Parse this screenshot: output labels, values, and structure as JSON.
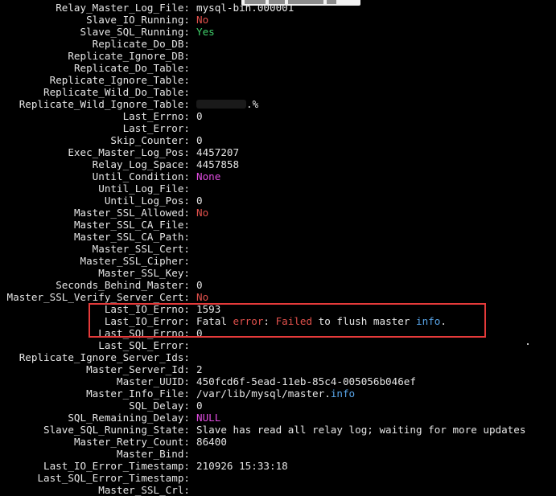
{
  "terminal": {
    "lines": [
      {
        "key": "Relay_Master_Log_File:",
        "segments": [
          {
            "text": "mysql-bin.000001",
            "color": "normal"
          }
        ]
      },
      {
        "key": "Slave_IO_Running:",
        "segments": [
          {
            "text": "No",
            "color": "red"
          }
        ]
      },
      {
        "key": "Slave_SQL_Running:",
        "segments": [
          {
            "text": "Yes",
            "color": "green"
          }
        ]
      },
      {
        "key": "Replicate_Do_DB:",
        "segments": []
      },
      {
        "key": "Replicate_Ignore_DB:",
        "segments": []
      },
      {
        "key": "Replicate_Do_Table:",
        "segments": []
      },
      {
        "key": "Replicate_Ignore_Table:",
        "segments": []
      },
      {
        "key": "Replicate_Wild_Do_Table:",
        "segments": []
      },
      {
        "key": "Replicate_Wild_Ignore_Table:",
        "redacted": true,
        "segments": [
          {
            "text": ".%",
            "color": "normal"
          }
        ]
      },
      {
        "key": "Last_Errno:",
        "segments": [
          {
            "text": "0",
            "color": "normal"
          }
        ]
      },
      {
        "key": "Last_Error:",
        "segments": []
      },
      {
        "key": "Skip_Counter:",
        "segments": [
          {
            "text": "0",
            "color": "normal"
          }
        ]
      },
      {
        "key": "Exec_Master_Log_Pos:",
        "segments": [
          {
            "text": "4457207",
            "color": "normal"
          }
        ]
      },
      {
        "key": "Relay_Log_Space:",
        "segments": [
          {
            "text": "4457858",
            "color": "normal"
          }
        ]
      },
      {
        "key": "Until_Condition:",
        "segments": [
          {
            "text": "None",
            "color": "magenta"
          }
        ]
      },
      {
        "key": "Until_Log_File:",
        "segments": []
      },
      {
        "key": "Until_Log_Pos:",
        "segments": [
          {
            "text": "0",
            "color": "normal"
          }
        ]
      },
      {
        "key": "Master_SSL_Allowed:",
        "segments": [
          {
            "text": "No",
            "color": "red"
          }
        ]
      },
      {
        "key": "Master_SSL_CA_File:",
        "segments": []
      },
      {
        "key": "Master_SSL_CA_Path:",
        "segments": []
      },
      {
        "key": "Master_SSL_Cert:",
        "segments": []
      },
      {
        "key": "Master_SSL_Cipher:",
        "segments": []
      },
      {
        "key": "Master_SSL_Key:",
        "segments": []
      },
      {
        "key": "Seconds_Behind_Master:",
        "segments": [
          {
            "text": "0",
            "color": "normal"
          }
        ]
      },
      {
        "key": "Master_SSL_Verify_Server_Cert:",
        "segments": [
          {
            "text": "No",
            "color": "red"
          }
        ]
      },
      {
        "key": "Last_IO_Errno:",
        "segments": [
          {
            "text": "1593",
            "color": "normal"
          }
        ]
      },
      {
        "key": "Last_IO_Error:",
        "segments": [
          {
            "text": "Fatal ",
            "color": "normal"
          },
          {
            "text": "error",
            "color": "red"
          },
          {
            "text": ": ",
            "color": "normal"
          },
          {
            "text": "Failed",
            "color": "red"
          },
          {
            "text": " to flush master ",
            "color": "normal"
          },
          {
            "text": "info",
            "color": "blue"
          },
          {
            "text": ".",
            "color": "normal"
          }
        ]
      },
      {
        "key": "Last_SQL_Errno:",
        "segments": [
          {
            "text": "0",
            "color": "normal"
          }
        ]
      },
      {
        "key": "Last_SQL_Error:",
        "segments": []
      },
      {
        "key": "Replicate_Ignore_Server_Ids:",
        "segments": []
      },
      {
        "key": "Master_Server_Id:",
        "segments": [
          {
            "text": "2",
            "color": "normal"
          }
        ]
      },
      {
        "key": "Master_UUID:",
        "segments": [
          {
            "text": "450fcd6f-5ead-11eb-85c4-005056b046ef",
            "color": "normal"
          }
        ]
      },
      {
        "key": "Master_Info_File:",
        "segments": [
          {
            "text": "/var/lib/mysql/master.",
            "color": "normal"
          },
          {
            "text": "info",
            "color": "blue"
          }
        ]
      },
      {
        "key": "SQL_Delay:",
        "segments": [
          {
            "text": "0",
            "color": "normal"
          }
        ]
      },
      {
        "key": "SQL_Remaining_Delay:",
        "segments": [
          {
            "text": "NULL",
            "color": "magenta"
          }
        ]
      },
      {
        "key": "Slave_SQL_Running_State:",
        "segments": [
          {
            "text": "Slave has read all relay log; waiting for more updates",
            "color": "normal"
          }
        ]
      },
      {
        "key": "Master_Retry_Count:",
        "segments": [
          {
            "text": "86400",
            "color": "normal"
          }
        ]
      },
      {
        "key": "Master_Bind:",
        "segments": []
      },
      {
        "key": "Last_IO_Error_Timestamp:",
        "segments": [
          {
            "text": "210926 15:33:18",
            "color": "normal"
          }
        ]
      },
      {
        "key": "Last_SQL_Error_Timestamp:",
        "segments": []
      },
      {
        "key": "Master_SSL_Crl:",
        "segments": []
      }
    ]
  },
  "colors": {
    "background": "#000000",
    "text": "#e6e6e6",
    "red": "#e2514c",
    "green": "#3fcf6a",
    "magenta": "#e24de2",
    "blue": "#59a6ea",
    "annotation": "#e53a3a"
  }
}
